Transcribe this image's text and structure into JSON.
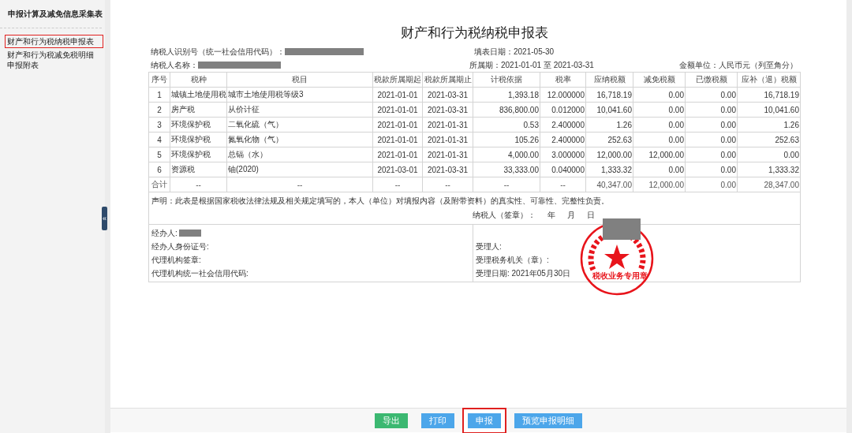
{
  "sidebar": {
    "title": "申报计算及减免信息采集表",
    "items": [
      {
        "label": "财产和行为税纳税申报表",
        "selected": true
      },
      {
        "label": "财产和行为税减免税明细申报附表",
        "selected": false
      }
    ]
  },
  "collapse_handle": "«",
  "form": {
    "title": "财产和行为税纳税申报表",
    "taxpayer_id_label": "纳税人识别号（统一社会信用代码）：",
    "fill_date": "填表日期：2021-05-30",
    "taxpayer_name_label": "纳税人名称：",
    "period": "所属期：2021-01-01 至 2021-03-31",
    "unit": "金额单位：人民币元（列至角分）"
  },
  "table": {
    "columns": [
      "序号",
      "税种",
      "税目",
      "税款所属期起",
      "税款所属期止",
      "计税依据",
      "税率",
      "应纳税额",
      "减免税额",
      "已缴税额",
      "应补（退）税额"
    ],
    "rows": [
      [
        "1",
        "城镇土地使用税",
        "城市土地使用税等级3",
        "2021-01-01",
        "2021-03-31",
        "1,393.18",
        "12.000000",
        "16,718.19",
        "0.00",
        "0.00",
        "16,718.19"
      ],
      [
        "2",
        "房产税",
        "从价计征",
        "2021-01-01",
        "2021-03-31",
        "836,800.00",
        "0.012000",
        "10,041.60",
        "0.00",
        "0.00",
        "10,041.60"
      ],
      [
        "3",
        "环境保护税",
        "二氧化硫（气）",
        "2021-01-01",
        "2021-01-31",
        "0.53",
        "2.400000",
        "1.26",
        "0.00",
        "0.00",
        "1.26"
      ],
      [
        "4",
        "环境保护税",
        "氮氧化物（气）",
        "2021-01-01",
        "2021-01-31",
        "105.26",
        "2.400000",
        "252.63",
        "0.00",
        "0.00",
        "252.63"
      ],
      [
        "5",
        "环境保护税",
        "总镉（水）",
        "2021-01-01",
        "2021-01-31",
        "4,000.00",
        "3.000000",
        "12,000.00",
        "12,000.00",
        "0.00",
        "0.00"
      ],
      [
        "6",
        "资源税",
        "铀(2020)",
        "2021-03-01",
        "2021-03-31",
        "33,333.00",
        "0.040000",
        "1,333.32",
        "0.00",
        "0.00",
        "1,333.32"
      ]
    ],
    "total": [
      "合计",
      "--",
      "--",
      "--",
      "--",
      "--",
      "--",
      "40,347.00",
      "12,000.00",
      "0.00",
      "28,347.00"
    ]
  },
  "declaration": {
    "text": "声明：此表是根据国家税收法律法规及相关规定填写的，本人（单位）对填报内容（及附带资料）的真实性、可靠性、完整性负责。",
    "signature": "纳税人（签章）：",
    "year": "年",
    "month": "月",
    "day": "日"
  },
  "agent_fields": [
    "经办人:",
    "经办人身份证号:",
    "代理机构签章:",
    "代理机构统一社会信用代码:"
  ],
  "office_fields": [
    "受理人:",
    "受理税务机关（章）:",
    "受理日期: 2021年05月30日"
  ],
  "stamp": {
    "text": "税收业务专用章"
  },
  "buttons": [
    {
      "label": "导出",
      "kind": "green",
      "highlighted": false
    },
    {
      "label": "打印",
      "kind": "blue",
      "highlighted": false
    },
    {
      "label": "申报",
      "kind": "blue",
      "highlighted": true
    },
    {
      "label": "预览申报明细",
      "kind": "blue",
      "highlighted": false
    }
  ]
}
